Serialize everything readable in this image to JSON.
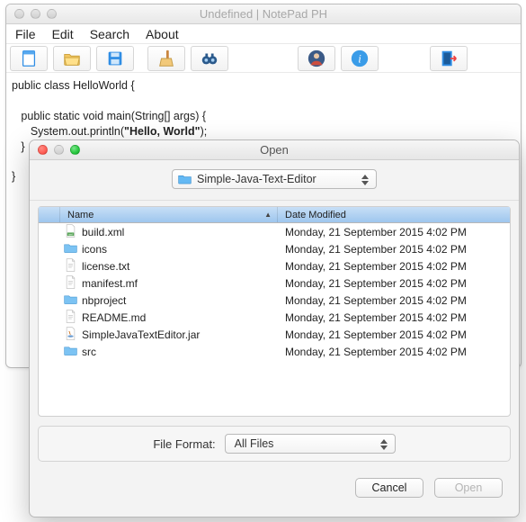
{
  "main": {
    "title": "Undefined | NotePad PH",
    "menu": {
      "file": "File",
      "edit": "Edit",
      "search": "Search",
      "about": "About"
    },
    "code": {
      "l1": "public class HelloWorld {",
      "l2": "",
      "l3": "   public static void main(String[] args) {",
      "l4pre": "      System.out.println(",
      "l4str": "\"Hello, World\"",
      "l4post": ");",
      "l5": "   }",
      "l6": "",
      "l7": "}"
    }
  },
  "dialog": {
    "title": "Open",
    "path_label": "Simple-Java-Text-Editor",
    "columns": {
      "name": "Name",
      "date": "Date Modified"
    },
    "files": [
      {
        "name": "build.xml",
        "type": "xml",
        "date": "Monday, 21 September 2015 4:02 PM"
      },
      {
        "name": "icons",
        "type": "folder",
        "date": "Monday, 21 September 2015 4:02 PM"
      },
      {
        "name": "license.txt",
        "type": "txt",
        "date": "Monday, 21 September 2015 4:02 PM"
      },
      {
        "name": "manifest.mf",
        "type": "txt",
        "date": "Monday, 21 September 2015 4:02 PM"
      },
      {
        "name": "nbproject",
        "type": "folder",
        "date": "Monday, 21 September 2015 4:02 PM"
      },
      {
        "name": "README.md",
        "type": "txt",
        "date": "Monday, 21 September 2015 4:02 PM"
      },
      {
        "name": "SimpleJavaTextEditor.jar",
        "type": "jar",
        "date": "Monday, 21 September 2015 4:02 PM"
      },
      {
        "name": "src",
        "type": "folder",
        "date": "Monday, 21 September 2015 4:02 PM"
      }
    ],
    "format_label": "File Format:",
    "format_value": "All Files",
    "cancel": "Cancel",
    "open": "Open"
  }
}
